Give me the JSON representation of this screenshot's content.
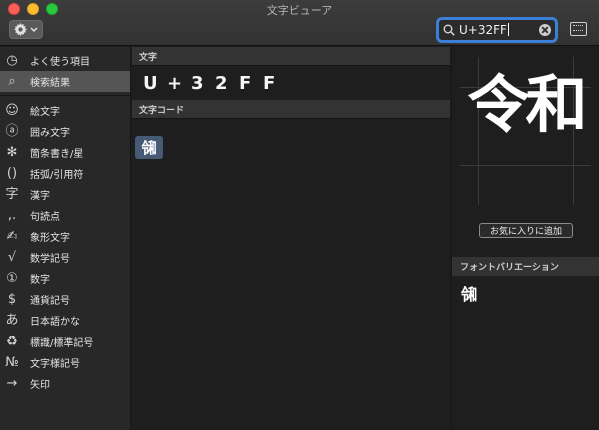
{
  "window": {
    "title": "文字ビューア"
  },
  "toolbar": {
    "action_icon": "gear-icon",
    "search": {
      "value": "U+32FF",
      "icon": "search-icon"
    }
  },
  "sidebar": {
    "items": [
      {
        "icon": "clock-icon",
        "glyph": "◷",
        "label": "よく使う項目"
      },
      {
        "icon": "search-icon",
        "glyph": "⌕",
        "label": "検索結果",
        "selected": true
      },
      {
        "icon": "smiley-icon",
        "glyph": "☺",
        "label": "絵文字"
      },
      {
        "icon": "circled-a-icon",
        "glyph": "ⓐ",
        "label": "囲み文字"
      },
      {
        "icon": "asterisk-icon",
        "glyph": "✻",
        "label": "箇条書き/星"
      },
      {
        "icon": "parentheses-icon",
        "glyph": "()",
        "label": "括弧/引用符"
      },
      {
        "icon": "kanji-icon",
        "glyph": "字",
        "label": "漢字"
      },
      {
        "icon": "punctuation-icon",
        "glyph": ",.",
        "label": "句読点"
      },
      {
        "icon": "pictograph-icon",
        "glyph": "✍",
        "label": "象形文字"
      },
      {
        "icon": "square-root-icon",
        "glyph": "√",
        "label": "数学記号"
      },
      {
        "icon": "circled-1-icon",
        "glyph": "①",
        "label": "数字"
      },
      {
        "icon": "dollar-icon",
        "glyph": "$",
        "label": "通貨記号"
      },
      {
        "icon": "hiragana-icon",
        "glyph": "あ",
        "label": "日本語かな"
      },
      {
        "icon": "recycle-icon",
        "glyph": "♻",
        "label": "標識/標準記号"
      },
      {
        "icon": "numero-icon",
        "glyph": "№",
        "label": "文字様記号"
      },
      {
        "icon": "arrow-icon",
        "glyph": "→",
        "label": "矢印"
      }
    ]
  },
  "middle": {
    "char_header": "文字",
    "code_chars": [
      "U",
      "+",
      "3",
      "2",
      "F",
      "F"
    ],
    "code_header": "文字コード",
    "result_glyph": "㋿"
  },
  "detail": {
    "preview": "令和",
    "favorite_label": "お気に入りに追加",
    "variation_header": "フォントバリエーション",
    "variation_glyph": "㋿"
  }
}
